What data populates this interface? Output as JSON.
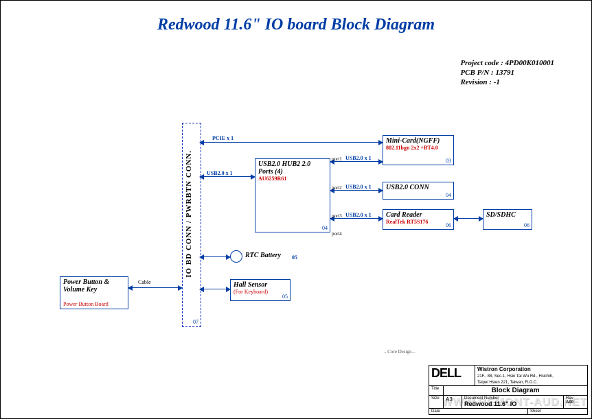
{
  "title": "Redwood 11.6\" IO board Block Diagram",
  "project": {
    "code_label": "Project code :",
    "code": "4PD00K010001",
    "pn_label": "PCB P/N :",
    "pn": "13791",
    "rev_label": "Revision :",
    "rev": "-1"
  },
  "bus": {
    "label": "IO BD CONN / PWRBTN CONN.",
    "ref": "07"
  },
  "blocks": {
    "pwrbtn": {
      "title": "Power Button & Volume Key",
      "sub": "Power Button Board",
      "cable": "Cable"
    },
    "hub": {
      "title": "USB2.0 HUB2 2.0 Ports (4)",
      "sub": "AU6259R61",
      "ref": "04"
    },
    "mini": {
      "title": "Mini-Card(NGFF)",
      "sub": "802.11bgn 2x2 +BT4.0",
      "ref": "03"
    },
    "usbconn": {
      "title": "USB2.0 CONN",
      "ref": "04"
    },
    "card": {
      "title": "Card Reader",
      "sub": "RealTek RT5S176",
      "ref": "06"
    },
    "sd": {
      "title": "SD/SDHC",
      "ref": "06"
    },
    "rtc": {
      "title": "RTC Battery",
      "ref": "05"
    },
    "hall": {
      "title": "Hall Sensor",
      "sub": "(For Keyboard)",
      "ref": "05"
    }
  },
  "signals": {
    "pcie": "PCIE x 1",
    "usb": "USB2.0 x 1"
  },
  "ports": {
    "p1": "port1",
    "p2": "port2",
    "p3": "port3",
    "p4": "port4"
  },
  "footer": {
    "dell": "DELL",
    "wistron": "Wistron Corporation",
    "addr": "21F., 88, Sec.1, Hsin Tai Wu Rd., Hsichih,\nTaipei Hsien 221, Taiwan, R.O.C.",
    "blockdiag": "Block Diagram",
    "docnum": "Document Number",
    "sheetname": "Redwood 11.6\" IO",
    "size": "Size",
    "sizeval": "A3",
    "rev": "Rev",
    "revval": "A00",
    "date": "Date",
    "sheet": "Sheet"
  },
  "core": "...Core Design...",
  "watermark": "WWW.REMONT-AUD.NET"
}
